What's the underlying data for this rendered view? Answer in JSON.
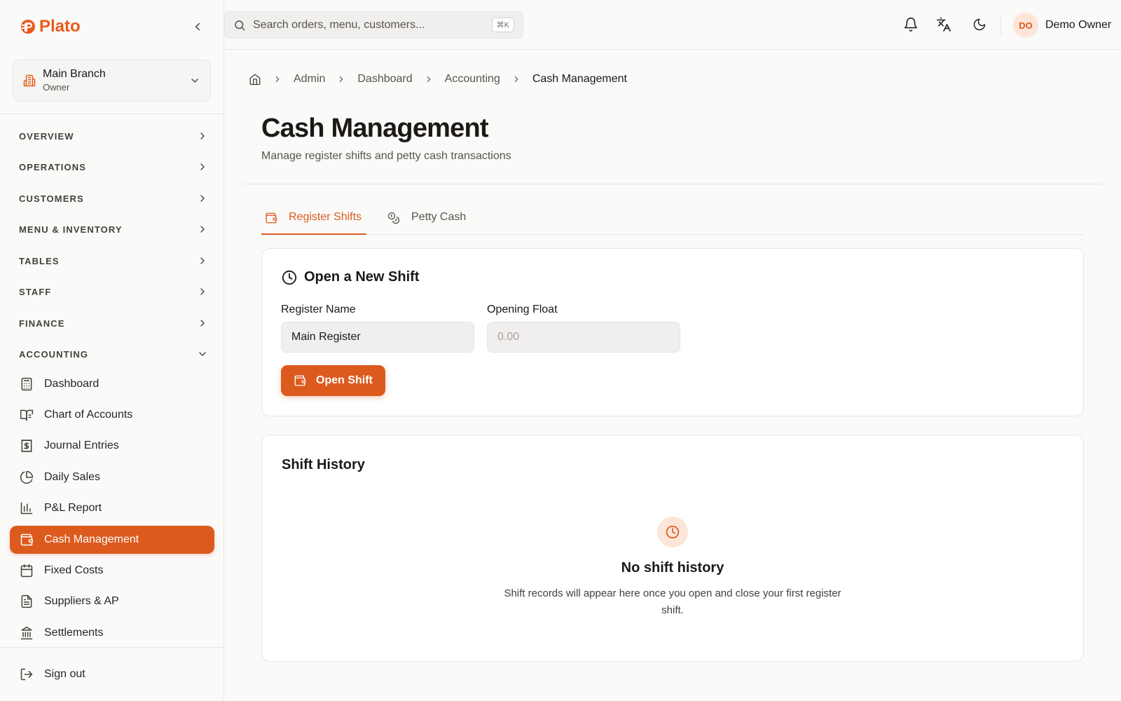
{
  "app": {
    "name": "Plato",
    "brand_color": "#dc5a1e"
  },
  "sidebar": {
    "collapse_icon": "chevron-left-icon",
    "branch": {
      "name": "Main Branch",
      "role": "Owner",
      "icon": "building-icon"
    },
    "sections": [
      {
        "label": "OVERVIEW",
        "expanded": false
      },
      {
        "label": "OPERATIONS",
        "expanded": false
      },
      {
        "label": "CUSTOMERS",
        "expanded": false
      },
      {
        "label": "MENU & INVENTORY",
        "expanded": false
      },
      {
        "label": "TABLES",
        "expanded": false
      },
      {
        "label": "STAFF",
        "expanded": false
      },
      {
        "label": "FINANCE",
        "expanded": false
      },
      {
        "label": "ACCOUNTING",
        "expanded": true
      }
    ],
    "accounting_items": [
      {
        "label": "Dashboard",
        "icon": "calculator-icon",
        "active": false
      },
      {
        "label": "Chart of Accounts",
        "icon": "book-open-icon",
        "active": false
      },
      {
        "label": "Journal Entries",
        "icon": "receipt-dollar-icon",
        "active": false
      },
      {
        "label": "Daily Sales",
        "icon": "pie-chart-icon",
        "active": false
      },
      {
        "label": "P&L Report",
        "icon": "bar-chart-icon",
        "active": false
      },
      {
        "label": "Cash Management",
        "icon": "wallet-icon",
        "active": true
      },
      {
        "label": "Fixed Costs",
        "icon": "calendar-icon",
        "active": false
      },
      {
        "label": "Suppliers & AP",
        "icon": "file-text-icon",
        "active": false
      },
      {
        "label": "Settlements",
        "icon": "landmark-icon",
        "active": false
      }
    ],
    "sign_out": "Sign out"
  },
  "topbar": {
    "search": {
      "placeholder": "Search orders, menu, customers...",
      "value": "",
      "shortcut": "⌘K"
    },
    "user": {
      "initials": "DO",
      "name": "Demo Owner"
    }
  },
  "breadcrumb": [
    "Admin",
    "Dashboard",
    "Accounting",
    "Cash Management"
  ],
  "page": {
    "title": "Cash Management",
    "subtitle": "Manage register shifts and petty cash transactions"
  },
  "tabs": [
    {
      "label": "Register Shifts",
      "active": true,
      "icon": "wallet-icon"
    },
    {
      "label": "Petty Cash",
      "active": false,
      "icon": "coins-icon"
    }
  ],
  "open_shift": {
    "title": "Open a New Shift",
    "register_label": "Register Name",
    "register_value": "Main Register",
    "float_label": "Opening Float",
    "float_placeholder": "0.00",
    "button": "Open Shift"
  },
  "history": {
    "title": "Shift History",
    "empty_title": "No shift history",
    "empty_desc": "Shift records will appear here once you open and close your first register shift."
  }
}
